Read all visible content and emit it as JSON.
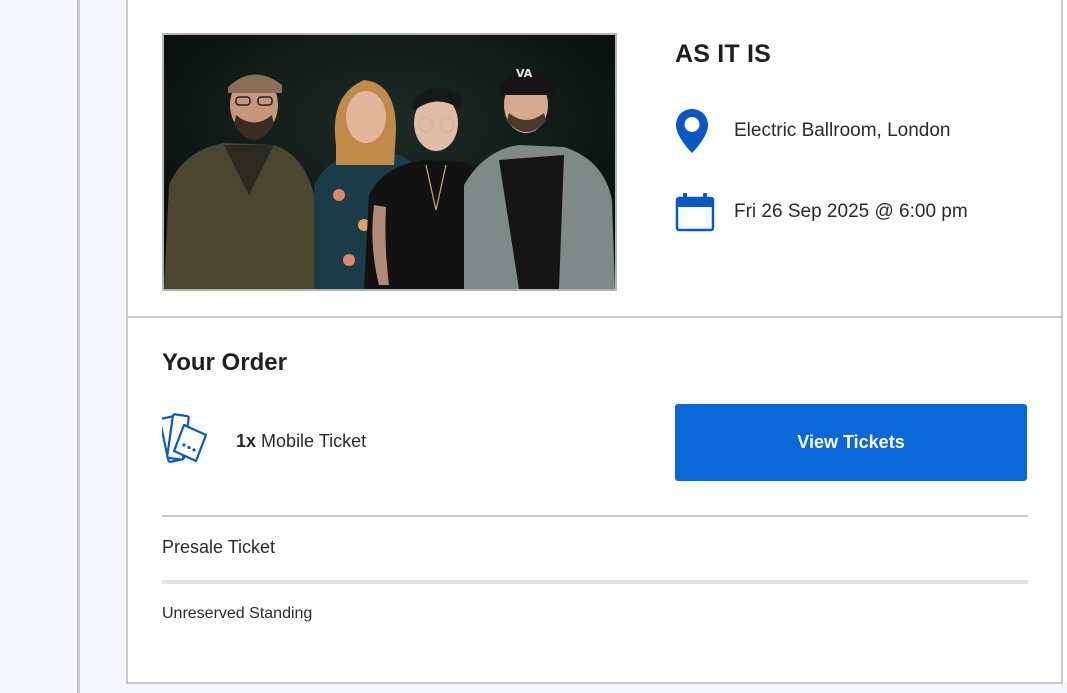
{
  "event": {
    "title": "AS IT IS",
    "image_alt": "Band photo",
    "location": "Electric Ballroom, London",
    "location_icon": "map-pin-icon",
    "date": "Fri 26 Sep 2025 @ 6:00 pm",
    "date_icon": "calendar-icon"
  },
  "order": {
    "heading": "Your Order",
    "ticket_icon": "tickets-icon",
    "quantity": "1x",
    "ticket_label": "Mobile Ticket",
    "view_button": "View Tickets",
    "ticket_type": "Presale Ticket",
    "ticket_description": "Unreserved Standing"
  },
  "colors": {
    "accent": "#0a67d6",
    "icon_blue": "#0a58c2",
    "border": "#c9c9c9",
    "rail_background": "#f4f6fb"
  }
}
